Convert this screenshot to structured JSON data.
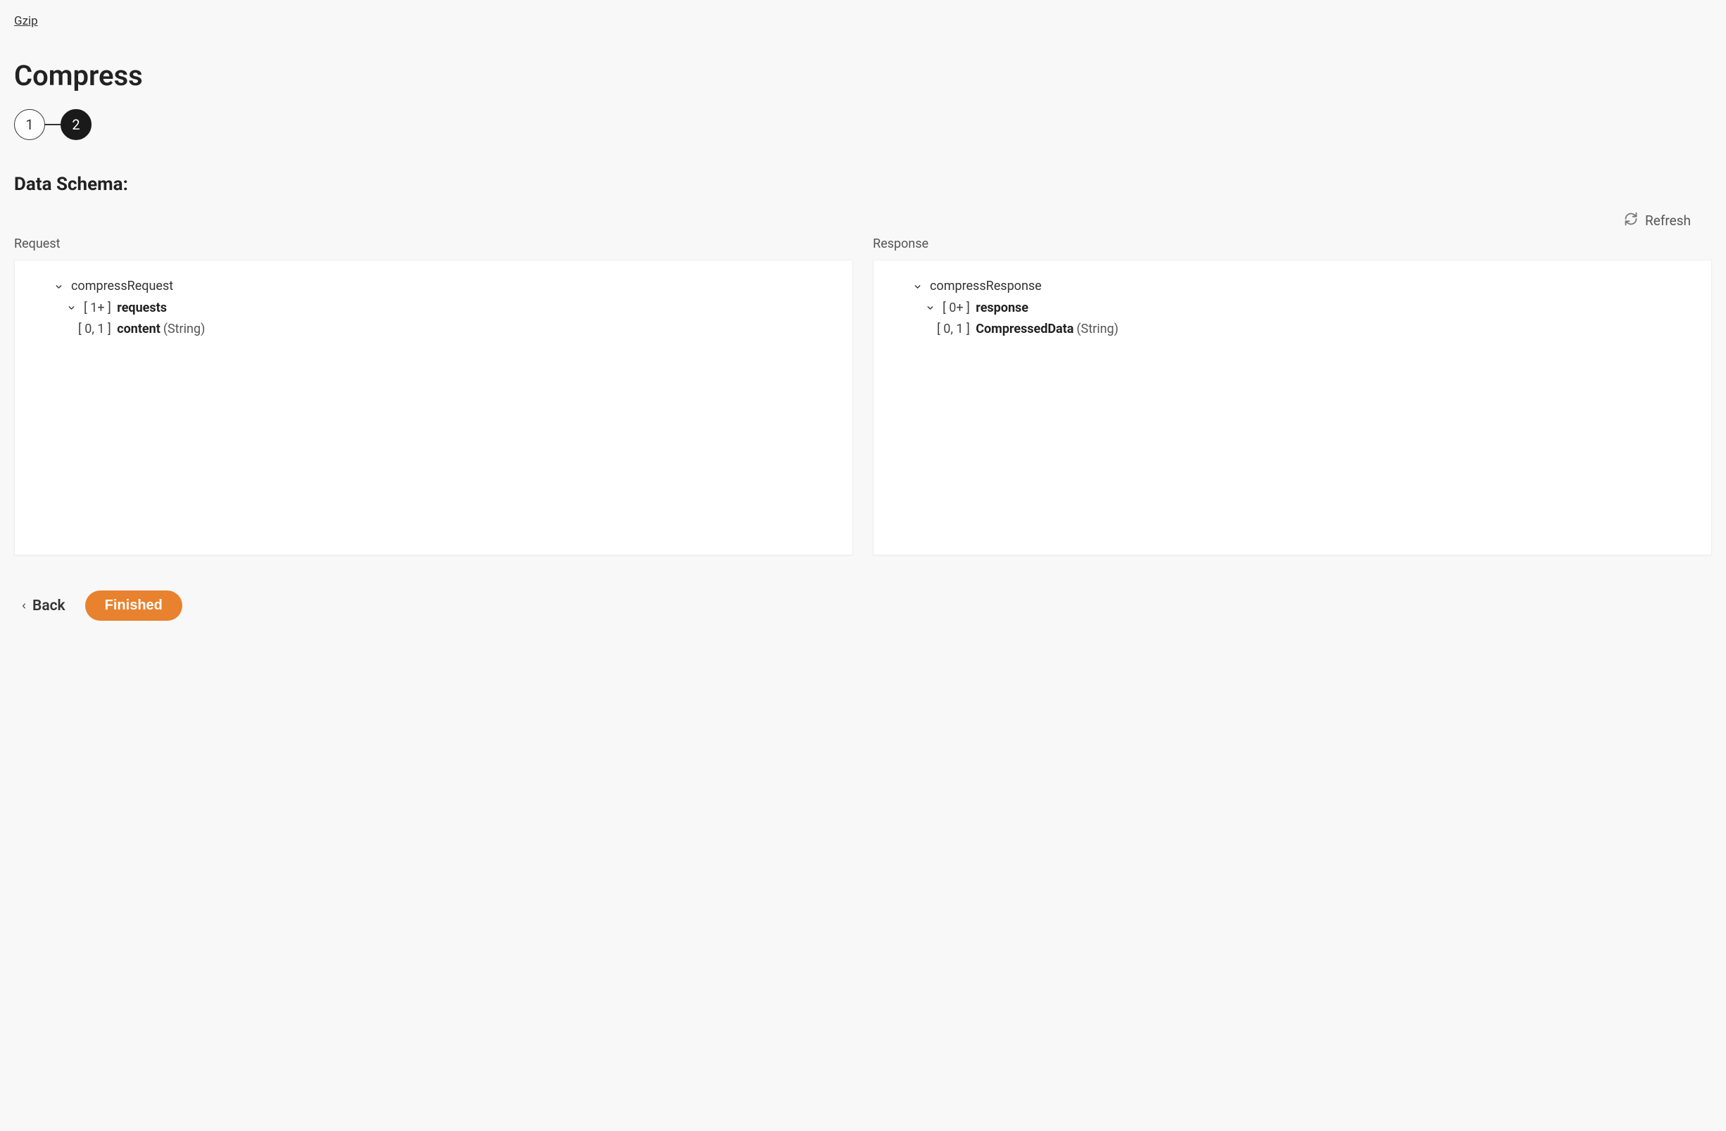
{
  "breadcrumb": "Gzip",
  "title": "Compress",
  "stepper": {
    "step1": "1",
    "step2": "2",
    "activeIndex": 2
  },
  "section_heading": "Data Schema:",
  "refresh_label": "Refresh",
  "request_label": "Request",
  "response_label": "Response",
  "request_tree": {
    "root": "compressRequest",
    "child1_card": "[ 1+ ]",
    "child1_name": "requests",
    "child2_card": "[ 0, 1 ]",
    "child2_name": "content",
    "child2_type": "(String)"
  },
  "response_tree": {
    "root": "compressResponse",
    "child1_card": "[ 0+ ]",
    "child1_name": "response",
    "child2_card": "[ 0, 1 ]",
    "child2_name": "CompressedData",
    "child2_type": "(String)"
  },
  "actions": {
    "back": "Back",
    "finished": "Finished"
  }
}
